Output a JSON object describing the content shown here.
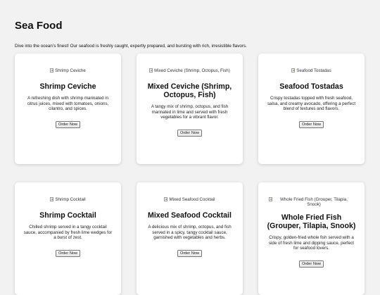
{
  "page": {
    "title": "Sea Food",
    "intro": "Dive into the ocean’s finest! Our seafood is freshly caught, expertly prepared, and bursting with rich, irresistible flavors."
  },
  "cards": [
    {
      "image_alt": "Shrimp Ceviche",
      "title": "Shrimp Ceviche",
      "description": "A refreshing dish with shrimp marinated in citrus juices, mixed with tomatoes, onions, cilantro, and spices.",
      "button_label": "Order Now"
    },
    {
      "image_alt": "Mixed Ceviche (Shrimp, Octopus, Fish)",
      "title": "Mixed Ceviche (Shrimp, Octopus, Fish)",
      "description": "A tangy mix of shrimp, octopus, and fish marinated in lime and served with fresh vegetables for a vibrant flavor.",
      "button_label": "Order Now"
    },
    {
      "image_alt": "Seafood Tostadas",
      "title": "Seafood Tostadas",
      "description": "Crispy tostadas topped with fresh seafood, salsa, and creamy avocado, offering a perfect blend of textures and flavors.",
      "button_label": "Order Now"
    },
    {
      "image_alt": "Shrimp Cocktail",
      "title": "Shrimp Cocktail",
      "description": "Chilled shrimp served in a tangy cocktail sauce, accompanied by fresh lime wedges for a burst of zest.",
      "button_label": "Order Now"
    },
    {
      "image_alt": "Mixed Seafood Cocktail",
      "title": "Mixed Seafood Cocktail",
      "description": "A delicious mix of shrimp, octopus, and fish served in a spicy, tangy cocktail sauce, garnished with vegetables and herbs.",
      "button_label": "Order Now"
    },
    {
      "image_alt": "Whole Fried Fish (Grouper, Tilapia, Snook)",
      "title": "Whole Fried Fish (Grouper, Tilapia, Snook)",
      "description": "Crispy, golden-fried whole fish served with a side of fresh lime and dipping sauce, perfect for seafood lovers.",
      "button_label": "Order Now"
    }
  ]
}
